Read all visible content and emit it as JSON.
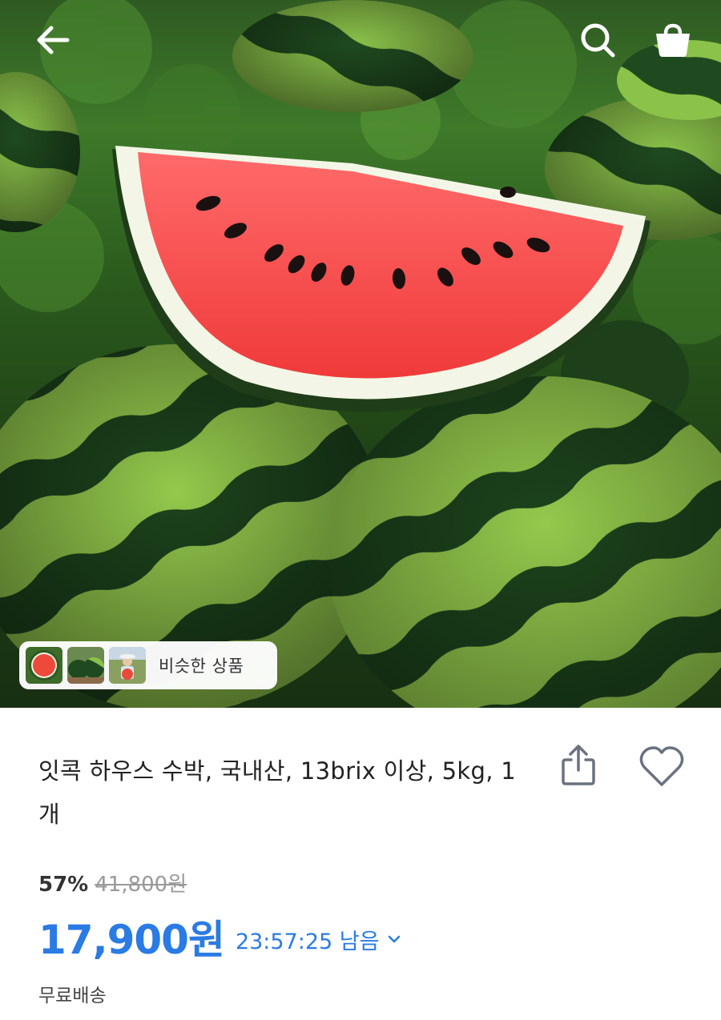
{
  "hero": {
    "similar_products_label": "비슷한 상품"
  },
  "topbar": {
    "icons": [
      "back-arrow-icon",
      "search-icon",
      "shopping-bag-icon"
    ]
  },
  "product": {
    "title": "잇콕 하우스 수박, 국내산, 13brix 이상, 5kg, 1개",
    "discount_rate": "57%",
    "original_price": "41,800원",
    "sale_price": "17,900원",
    "countdown": "23:57:25 남음",
    "shipping": "무료배송"
  },
  "colors": {
    "price_blue": "#2a7be4",
    "strike_gray": "#999999"
  }
}
